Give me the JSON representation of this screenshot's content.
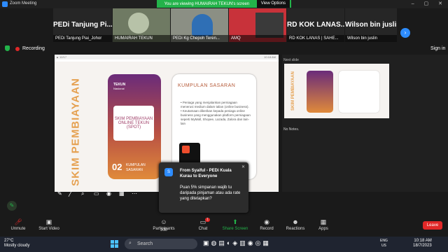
{
  "window": {
    "title": "Zoom Meeting"
  },
  "share_banner": {
    "text": "You are viewing HUMAIRAH TEKUN's screen",
    "view_options": "View Options"
  },
  "thumbnails": [
    {
      "big": "PEDi Tanjung Pi...",
      "label": "PEDi Tanjung Piai_Johor"
    },
    {
      "big": "",
      "label": "HUMAIRAH TEKUN"
    },
    {
      "big": "",
      "label": "PEDi Kg Chepoh Teren..."
    },
    {
      "big": "",
      "label": "AMQ"
    },
    {
      "big": "RD KOK LANAS...",
      "label": "RD KOK LANAS | SAHE..."
    },
    {
      "big": "Wilson bin juslin",
      "label": "Wilson bin juslin"
    }
  ],
  "recording": {
    "label": "Recording",
    "signin": "Sign in"
  },
  "slide_header": {
    "left": "▲ 12/17",
    "right": "10:18 AM"
  },
  "slide": {
    "vertical_title": "SKIM PEMBIAYAAN",
    "card_brand": "TEKUN",
    "card_brand_sub": "Nasional",
    "card_box": "SKIM PEMBIAYAAN ONLINE TEKUN (SPOT)",
    "card_num": "02",
    "card_caption": "KUMPULAN SASARAN",
    "card2_title": "KUMPULAN SASARAN",
    "card2_body": "• Peniaga yang menjalankan perniagaan menerusi medium dalam talian (online business). • Keutamaan diberikan kepada peniaga online business yang menggunakan platform perniagaan seperti MyMall, Shopee, Lazada, Zalora dan lain-lain"
  },
  "notes": {
    "next": "Next slide",
    "empty": "No Notes."
  },
  "notification": {
    "avatar": "S",
    "from": "From Syaiful - PEDi Kuala Kurau to Everyone",
    "message": "Puan 5% simpanan wajib tu daripada pinjaman atau ada rate yang ditetapkan?"
  },
  "toolbar": {
    "unmute": "Unmute",
    "start_video": "Start Video",
    "participants": "Participants",
    "participants_count": "300",
    "chat": "Chat",
    "chat_badge": "1",
    "share": "Share Screen",
    "record": "Record",
    "reactions": "Reactions",
    "apps": "Apps",
    "leave": "Leave"
  },
  "taskbar": {
    "weather_temp": "27°C",
    "weather_desc": "Mostly cloudy",
    "search": "Search",
    "lang1": "ENG",
    "lang2": "US",
    "time": "10:18 AM",
    "date": "18/7/2023"
  }
}
